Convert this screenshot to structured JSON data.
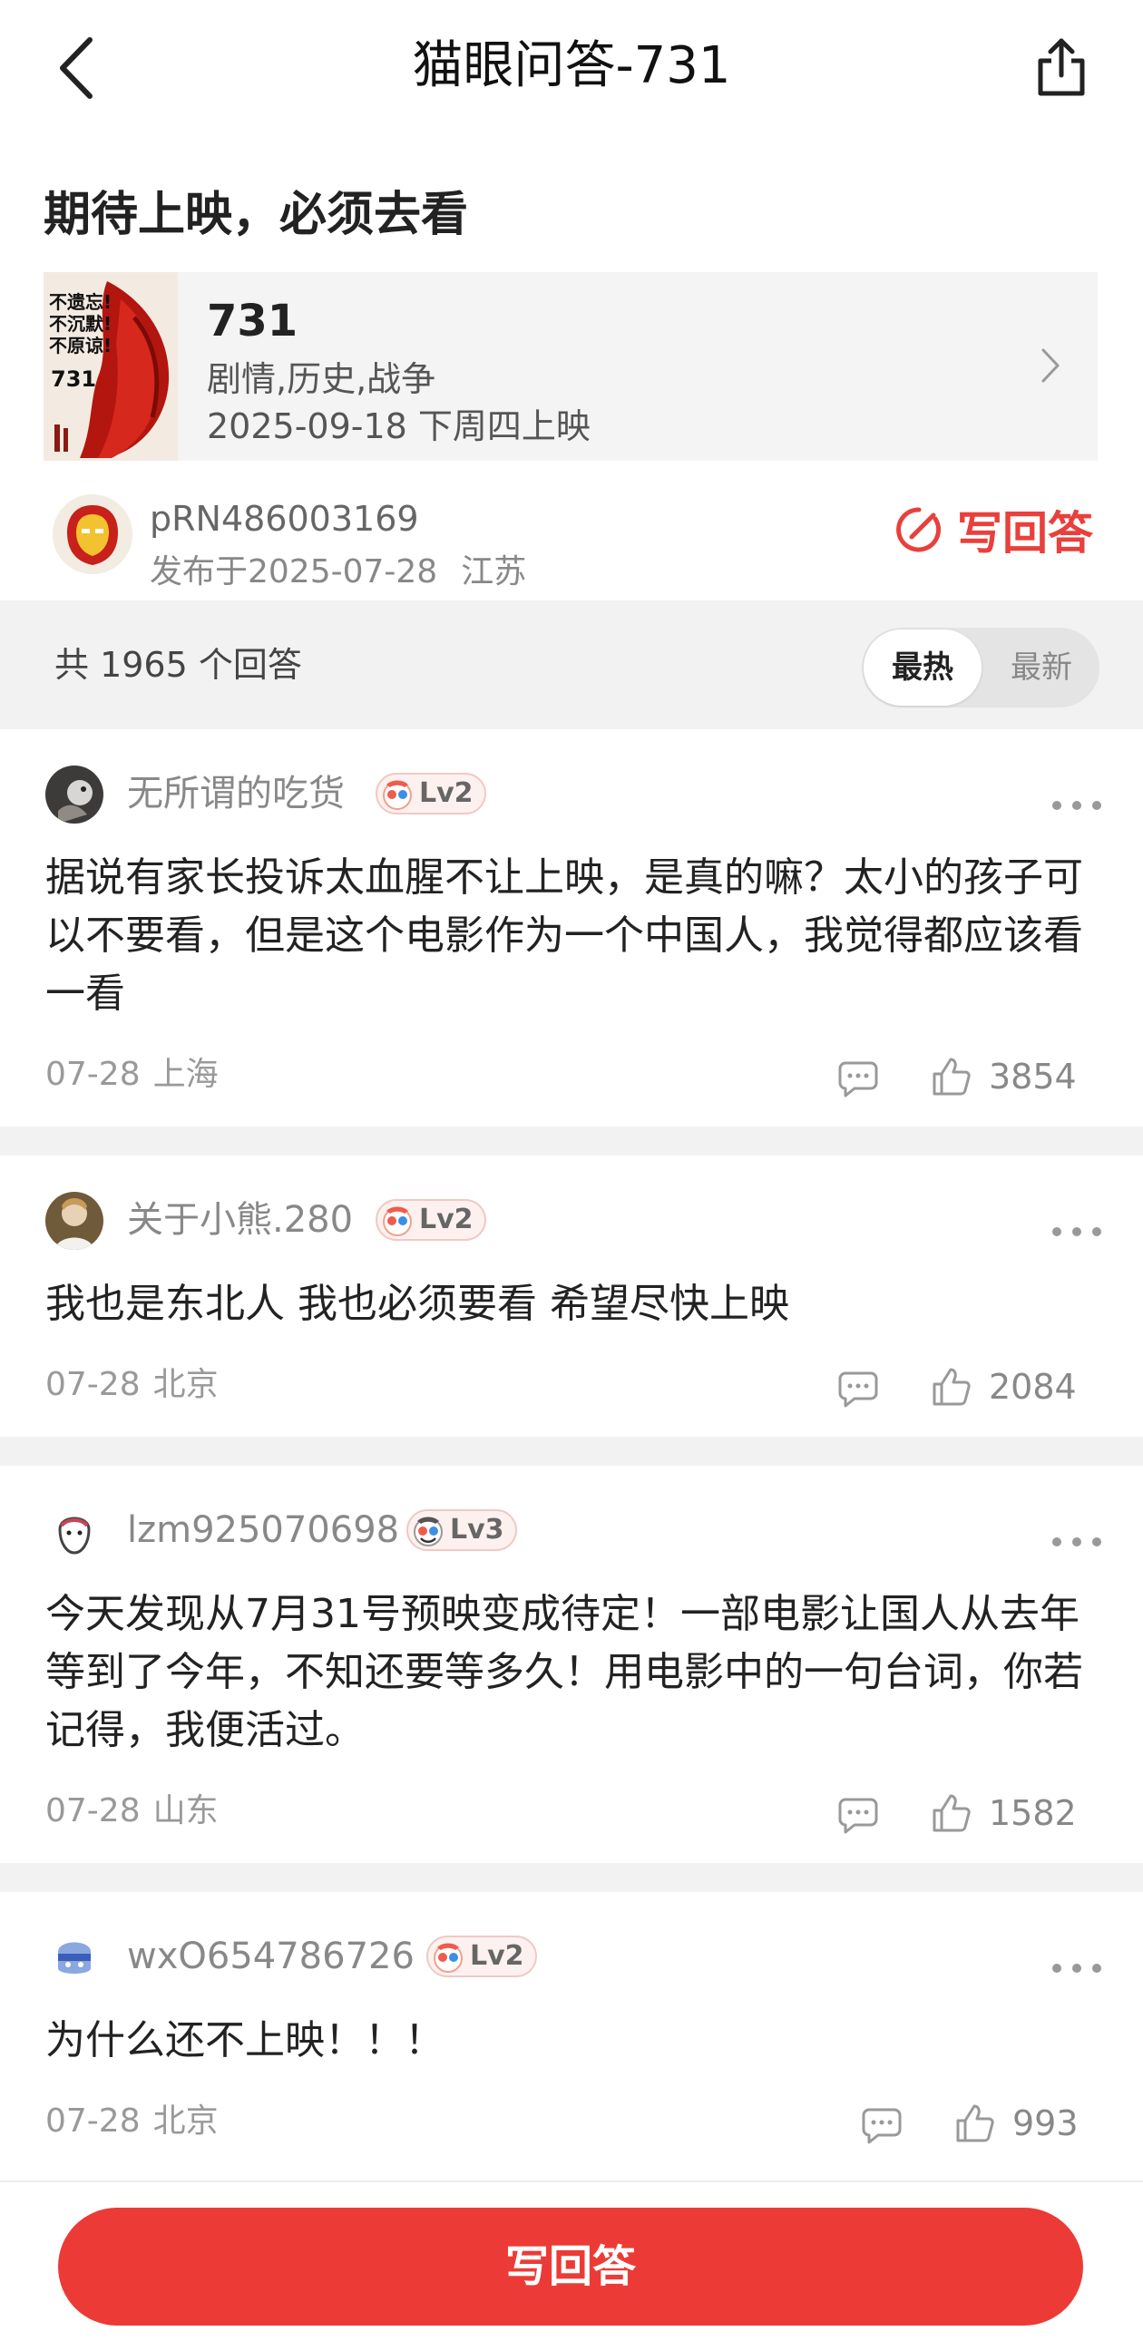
{
  "header": {
    "title": "猫眼问答-731",
    "back_icon": "chevron-left-icon",
    "share_icon": "share-icon"
  },
  "question": {
    "title": "期待上映，必须去看"
  },
  "movie": {
    "title": "731",
    "genre": "剧情,历史,战争",
    "release": "2025-09-18 下周四上映",
    "poster_text": [
      "不遗忘!",
      "不沉默!",
      "不原谅!",
      "731"
    ]
  },
  "asker": {
    "name": "pRN486003169",
    "published": "发布于2025-07-28",
    "location": "江苏",
    "write_label": "写回答"
  },
  "answers_bar": {
    "count_text": "共 1965 个回答",
    "sort_hot": "最热",
    "sort_new": "最新"
  },
  "answers": [
    {
      "name": "无所谓的吃货",
      "level": "Lv2",
      "text": "据说有家长投诉太血腥不让上映，是真的嘛？太小的孩子可以不要看，但是这个电影作为一个中国人，我觉得都应该看一看",
      "date": "07-28",
      "location": "上海",
      "likes": "3854"
    },
    {
      "name": "关于小熊.280",
      "level": "Lv2",
      "text": "我也是东北人 我也必须要看 希望尽快上映",
      "date": "07-28",
      "location": "北京",
      "likes": "2084"
    },
    {
      "name": "lzm925070698",
      "level": "Lv3",
      "text": "今天发现从7月31号预映变成待定！一部电影让国人从去年等到了今年，不知还要等多久！用电影中的一句台词，你若记得，我便活过。",
      "date": "07-28",
      "location": "山东",
      "likes": "1582"
    },
    {
      "name": "wxO654786726",
      "level": "Lv2",
      "text": "为什么还不上映！！！",
      "date": "07-28",
      "location": "北京",
      "likes": "993"
    }
  ],
  "bottom": {
    "write_label": "写回答"
  },
  "colors": {
    "accent_red": "#ec3b36",
    "divider_gray": "#f2f2f2"
  }
}
